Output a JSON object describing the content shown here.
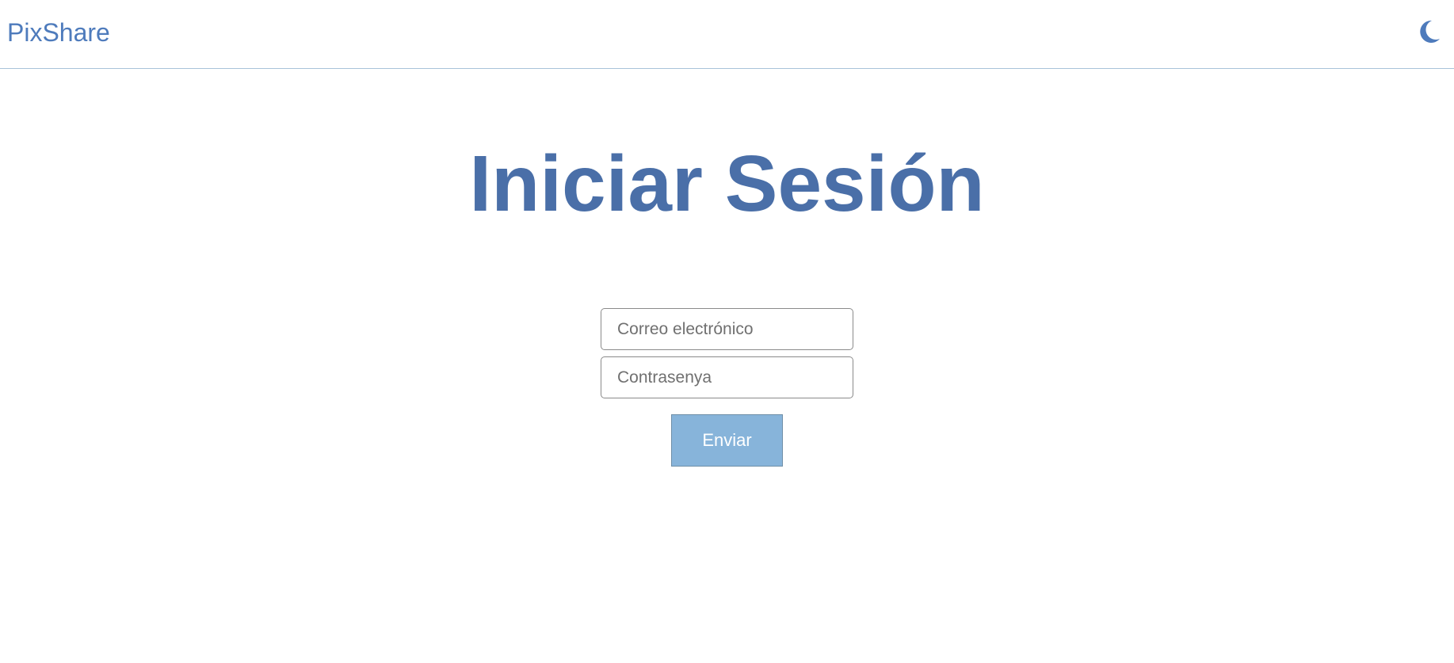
{
  "header": {
    "brand": "PixShare",
    "theme_toggle_icon": "moon-icon"
  },
  "main": {
    "title": "Iniciar Sesión",
    "email_placeholder": "Correo electrónico",
    "password_placeholder": "Contrasenya",
    "submit_label": "Enviar"
  },
  "colors": {
    "brand": "#4e7bbc",
    "heading": "#4a6fa8",
    "button": "#87b4da",
    "divider": "#a9c3d9"
  }
}
